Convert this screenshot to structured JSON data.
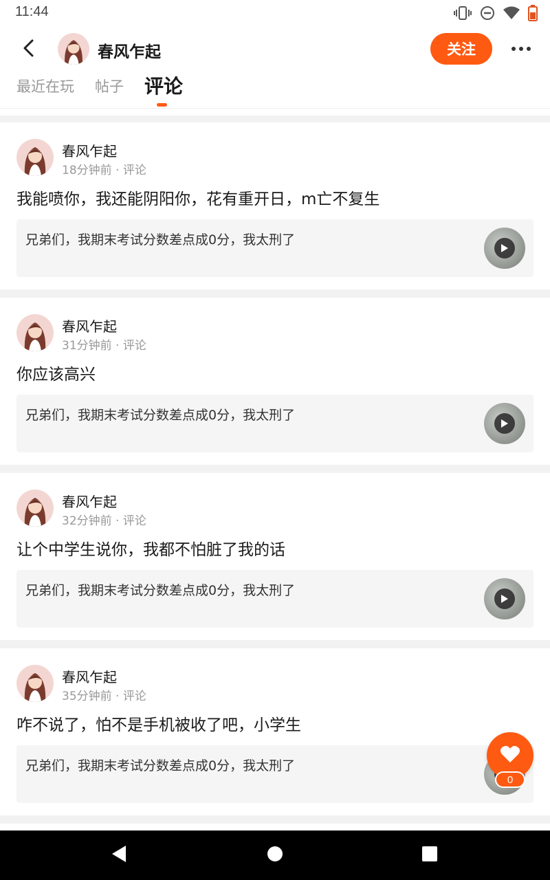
{
  "status_bar": {
    "time": "11:44",
    "icons": [
      "vibrate-icon",
      "do-not-disturb-icon",
      "wifi-icon",
      "battery-icon"
    ],
    "battery_color": "#e0531f"
  },
  "header": {
    "back_icon": "back-arrow-icon",
    "user_name": "春风乍起",
    "follow_label": "关注",
    "more_icon": "more-dots-icon",
    "accent_color": "#ff5a12"
  },
  "tabs": [
    {
      "label": "最近在玩",
      "active": false
    },
    {
      "label": "帖子",
      "active": false
    },
    {
      "label": "评论",
      "active": true
    }
  ],
  "posts": [
    {
      "author": "春风乍起",
      "time": "18分钟前",
      "type": "评论",
      "text": "我能喷你，我还能阴阳你，花有重开日，m亡不复生",
      "quote": "兄弟们，我期末考试分数差点成0分，我太刑了"
    },
    {
      "author": "春风乍起",
      "time": "31分钟前",
      "type": "评论",
      "text": "你应该高兴",
      "quote": "兄弟们，我期末考试分数差点成0分，我太刑了"
    },
    {
      "author": "春风乍起",
      "time": "32分钟前",
      "type": "评论",
      "text": "让个中学生说你，我都不怕脏了我的话",
      "quote": "兄弟们，我期末考试分数差点成0分，我太刑了"
    },
    {
      "author": "春风乍起",
      "time": "35分钟前",
      "type": "评论",
      "text": "咋不说了，怕不是手机被收了吧，小学生",
      "quote": "兄弟们，我期末考试分数差点成0分，我太刑了"
    }
  ],
  "like_button": {
    "icon": "heart-icon",
    "count": "0"
  },
  "nav_bar": {
    "icons": [
      "back-triangle-icon",
      "home-circle-icon",
      "recents-square-icon"
    ]
  }
}
